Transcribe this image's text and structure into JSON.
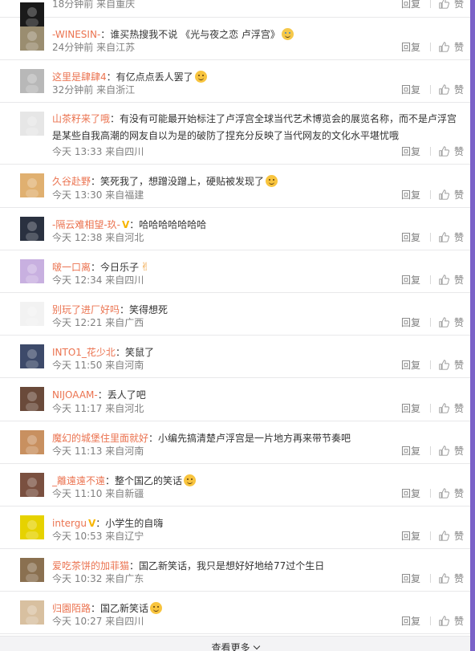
{
  "comments": [
    {
      "user": "",
      "text": "",
      "time": "18分钟前",
      "location": "来自重庆",
      "reply": "回复",
      "like": "赞",
      "avatar_color": "#1a1a1a",
      "emoji": ""
    },
    {
      "user": "-WINESIN-",
      "text": "：谁买热搜我不说 《光与夜之恋 卢浮宫》",
      "time": "24分钟前",
      "location": "来自江苏",
      "reply": "回复",
      "like": "赞",
      "avatar_color": "#9a8d70",
      "emoji": "cry"
    },
    {
      "user": "这里是肆肆4",
      "text": "：有亿点点丢人罢了",
      "time": "32分钟前",
      "location": "来自浙江",
      "reply": "回复",
      "like": "赞",
      "avatar_color": "#b8b8b8",
      "emoji": "grin"
    },
    {
      "user": "山茶籽来了哦",
      "text": "：有没有可能最开始标注了卢浮宫全球当代艺术博览会的展览名称，而不是卢浮宫是某些自我高潮的网友自以为是的破防了捏充分反映了当代网友的文化水平堪忧哦",
      "time": "今天 13:33",
      "location": "来自四川",
      "reply": "回复",
      "like": "赞",
      "avatar_color": "#e6e6e6",
      "emoji": ""
    },
    {
      "user": "久谷赴野",
      "text": "：笑死我了，想蹭没蹭上，硬贴被发现了",
      "time": "今天 13:30",
      "location": "来自福建",
      "reply": "回复",
      "like": "赞",
      "avatar_color": "#e0b070",
      "emoji": "grin"
    },
    {
      "user": "-隔云难相望-玖-",
      "text": "：哈哈哈哈哈哈哈",
      "time": "今天 12:38",
      "location": "来自河北",
      "reply": "回复",
      "like": "赞",
      "avatar_color": "#2a3140",
      "emoji": ""
    },
    {
      "user": "啵一口离",
      "text": "：今日乐子",
      "time": "今天 12:34",
      "location": "来自四川",
      "reply": "回复",
      "like": "赞",
      "avatar_color": "#c8b0e0",
      "emoji": ""
    },
    {
      "user": "别玩了进厂好吗",
      "text": "：笑得想死",
      "time": "今天 12:21",
      "location": "来自广西",
      "reply": "回复",
      "like": "赞",
      "avatar_color": "#f2f2f2",
      "emoji": ""
    },
    {
      "user": "INTO1_花少北",
      "text": "：笑鼠了",
      "time": "今天 11:50",
      "location": "来自河南",
      "reply": "回复",
      "like": "赞",
      "avatar_color": "#3d4a6a",
      "emoji": ""
    },
    {
      "user": "NIJOAAM-",
      "text": "：丢人了吧",
      "time": "今天 11:17",
      "location": "来自河北",
      "reply": "回复",
      "like": "赞",
      "avatar_color": "#6a4a3a",
      "emoji": ""
    },
    {
      "user": "魔幻的城堡住里面就好",
      "text": "：小编先搞清楚卢浮宫是一片地方再来带节奏吧",
      "time": "今天 11:13",
      "location": "来自河南",
      "reply": "回复",
      "like": "赞",
      "avatar_color": "#c89060",
      "emoji": ""
    },
    {
      "user": "_離遠遠不遠",
      "text": "：整个国乙的笑话",
      "time": "今天 11:10",
      "location": "来自新疆",
      "reply": "回复",
      "like": "赞",
      "avatar_color": "#7a5040",
      "emoji": "grin"
    },
    {
      "user": "intergu",
      "text": "：小学生的自嗨",
      "time": "今天 10:53",
      "location": "来自辽宁",
      "reply": "回复",
      "like": "赞",
      "avatar_color": "#e6d200",
      "emoji": ""
    },
    {
      "user": "爱吃茶饼的加菲猫",
      "text": "：国乙新笑话，我只是想好好地给77过个生日",
      "time": "今天 10:32",
      "location": "来自广东",
      "reply": "回复",
      "like": "赞",
      "avatar_color": "#8a7050",
      "emoji": ""
    },
    {
      "user": "归園陌路",
      "text": "：国乙新笑话",
      "time": "今天 10:27",
      "location": "来自四川",
      "reply": "回复",
      "like": "赞",
      "avatar_color": "#d8c0a0",
      "emoji": "grin"
    }
  ],
  "more_label": "查看更多",
  "icons": {
    "like": "thumbs-up-icon",
    "more": "chevron-down-icon",
    "vip": "v-badge-icon"
  },
  "colors": {
    "username": "#eb7350",
    "meta": "#808080",
    "vip": "#f7b500",
    "edge": "#7a62c8"
  }
}
